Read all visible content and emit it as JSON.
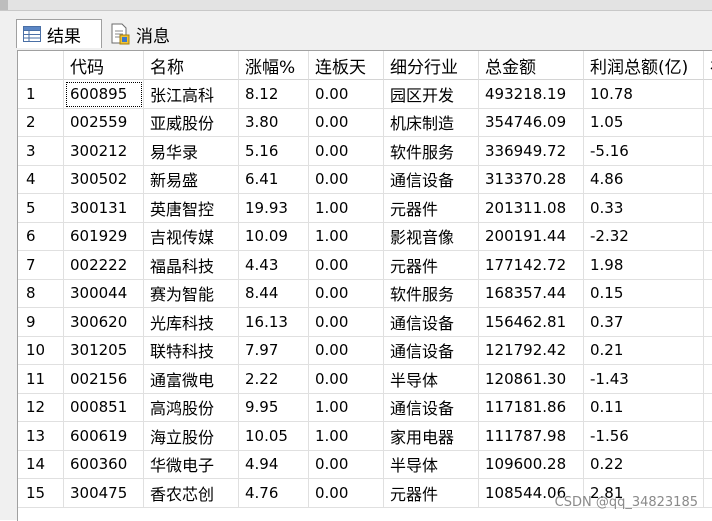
{
  "tabs": [
    {
      "label": "结果",
      "icon": "grid-icon"
    },
    {
      "label": "消息",
      "icon": "document-icon"
    }
  ],
  "columns": [
    "",
    "代码",
    "名称",
    "涨幅%",
    "连板天",
    "细分行业",
    "总金额",
    "利润总额(亿)",
    "礼"
  ],
  "rows": [
    [
      "1",
      "600895",
      "张江高科",
      "8.12",
      "0.00",
      "园区开发",
      "493218.19",
      "10.78"
    ],
    [
      "2",
      "002559",
      "亚威股份",
      "3.80",
      "0.00",
      "机床制造",
      "354746.09",
      "1.05"
    ],
    [
      "3",
      "300212",
      "易华录",
      "5.16",
      "0.00",
      "软件服务",
      "336949.72",
      "-5.16"
    ],
    [
      "4",
      "300502",
      "新易盛",
      "6.41",
      "0.00",
      "通信设备",
      "313370.28",
      "4.86"
    ],
    [
      "5",
      "300131",
      "英唐智控",
      "19.93",
      "1.00",
      "元器件",
      "201311.08",
      "0.33"
    ],
    [
      "6",
      "601929",
      "吉视传媒",
      "10.09",
      "1.00",
      "影视音像",
      "200191.44",
      "-2.32"
    ],
    [
      "7",
      "002222",
      "福晶科技",
      "4.43",
      "0.00",
      "元器件",
      "177142.72",
      "1.98"
    ],
    [
      "8",
      "300044",
      "赛为智能",
      "8.44",
      "0.00",
      "软件服务",
      "168357.44",
      "0.15"
    ],
    [
      "9",
      "300620",
      "光库科技",
      "16.13",
      "0.00",
      "通信设备",
      "156462.81",
      "0.37"
    ],
    [
      "10",
      "301205",
      "联特科技",
      "7.97",
      "0.00",
      "通信设备",
      "121792.42",
      "0.21"
    ],
    [
      "11",
      "002156",
      "通富微电",
      "2.22",
      "0.00",
      "半导体",
      "120861.30",
      "-1.43"
    ],
    [
      "12",
      "000851",
      "高鸿股份",
      "9.95",
      "1.00",
      "通信设备",
      "117181.86",
      "0.11"
    ],
    [
      "13",
      "600619",
      "海立股份",
      "10.05",
      "1.00",
      "家用电器",
      "111787.98",
      "-1.56"
    ],
    [
      "14",
      "600360",
      "华微电子",
      "4.94",
      "0.00",
      "半导体",
      "109600.28",
      "0.22"
    ],
    [
      "15",
      "300475",
      "香农芯创",
      "4.76",
      "0.00",
      "元器件",
      "108544.06",
      "2.81"
    ]
  ],
  "watermark": "CSDN @qq_34823185"
}
